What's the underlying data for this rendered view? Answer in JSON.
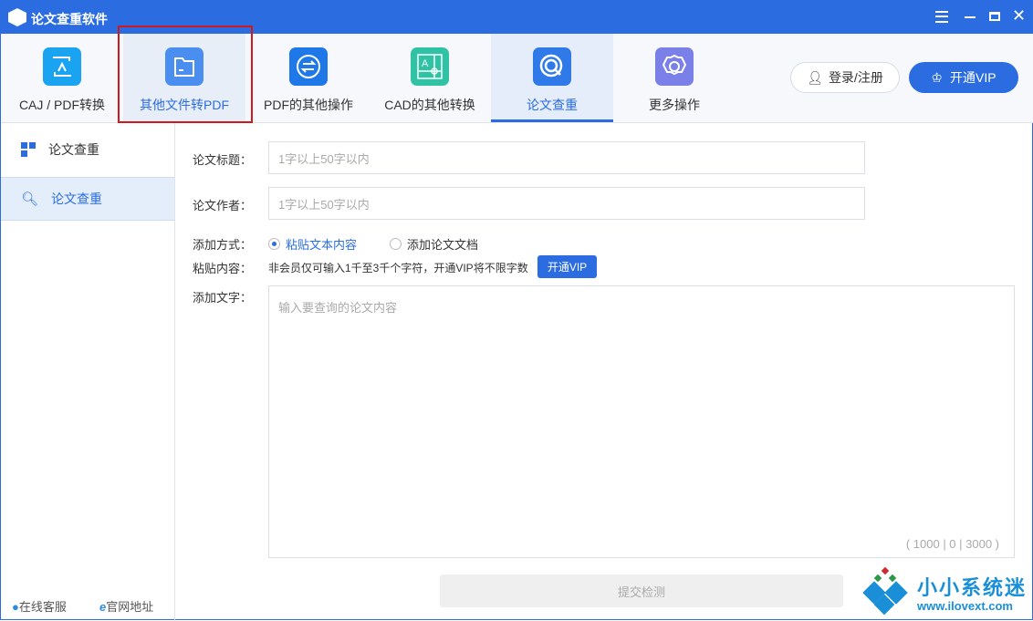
{
  "app": {
    "title": "论文查重软件"
  },
  "window_controls": {
    "menu": "menu-icon",
    "minimize": "minimize-icon",
    "maximize": "maximize-icon",
    "close": "close-icon"
  },
  "tabs": [
    {
      "label": "CAJ / PDF转换",
      "icon": "caj-pdf-convert-icon",
      "color": "#1aa3f0"
    },
    {
      "label": "其他文件转PDF",
      "icon": "folder-icon",
      "color": "#4a8ff0"
    },
    {
      "label": "PDF的其他操作",
      "icon": "swap-icon",
      "color": "#1f78e8"
    },
    {
      "label": "CAD的其他转换",
      "icon": "cad-icon",
      "color": "#2fc2a4"
    },
    {
      "label": "论文查重",
      "icon": "search-q-icon",
      "color": "#2f7ae8"
    },
    {
      "label": "更多操作",
      "icon": "gear-icon",
      "color": "#7a80e8"
    }
  ],
  "header": {
    "login": "登录/注册",
    "vip": "开通VIP"
  },
  "sidebar": {
    "items": [
      {
        "label": "论文查重"
      },
      {
        "label": "论文查重"
      }
    ],
    "footer": {
      "service": "在线客服",
      "website": "官网地址"
    }
  },
  "form": {
    "title_label": "论文标题：",
    "title_placeholder": "1字以上50字以内",
    "author_label": "论文作者：",
    "author_placeholder": "1字以上50字以内",
    "method_label": "添加方式：",
    "method_options": [
      "粘贴文本内容",
      "添加论文文档"
    ],
    "paste_label": "粘贴内容：",
    "paste_note": "非会员仅可输入1千至3千个字符，开通VIP将不限字数",
    "vip_button": "开通VIP",
    "text_label": "添加文字：",
    "text_placeholder": "输入要查询的论文内容",
    "counter": "( 1000 | 0 | 3000 )",
    "submit": "提交检测"
  },
  "watermark": {
    "name": "小小系统迷",
    "url": "www.ilovext.com"
  },
  "colors": {
    "accent": "#2b6de0",
    "highlight_box": "#d0181f"
  }
}
